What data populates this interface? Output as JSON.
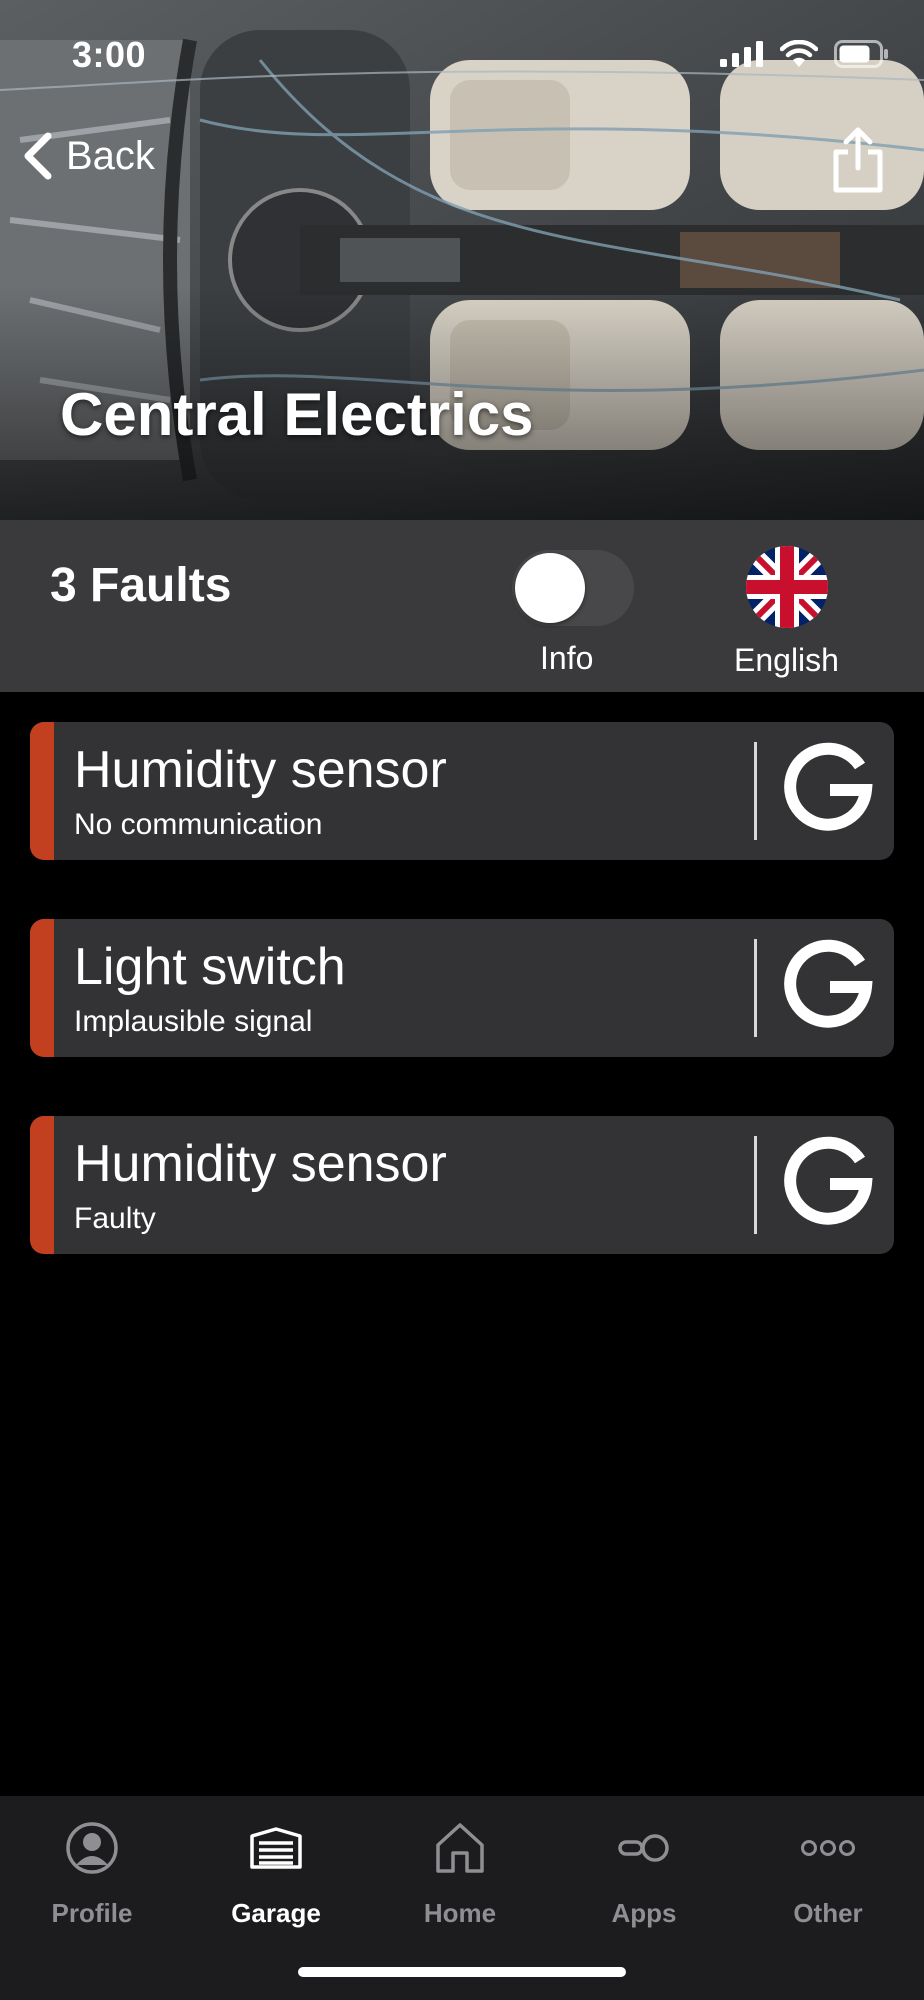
{
  "status_bar": {
    "time": "3:00"
  },
  "nav": {
    "back_label": "Back"
  },
  "hero": {
    "title": "Central Electrics"
  },
  "summary": {
    "fault_count_label": "3 Faults",
    "info_toggle_label": "Info",
    "info_toggle_on": false,
    "language_label": "English"
  },
  "faults": [
    {
      "title": "Humidity sensor",
      "subtitle": "No communication",
      "severity_color": "#c2401f"
    },
    {
      "title": "Light switch",
      "subtitle": "Implausible signal",
      "severity_color": "#c2401f"
    },
    {
      "title": "Humidity sensor",
      "subtitle": "Faulty",
      "severity_color": "#c2401f"
    }
  ],
  "tabbar": {
    "items": [
      {
        "label": "Profile",
        "icon": "profile-icon",
        "active": false
      },
      {
        "label": "Garage",
        "icon": "garage-icon",
        "active": true
      },
      {
        "label": "Home",
        "icon": "home-icon",
        "active": false
      },
      {
        "label": "Apps",
        "icon": "apps-icon",
        "active": false
      },
      {
        "label": "Other",
        "icon": "more-icon",
        "active": false
      }
    ]
  },
  "colors": {
    "background": "#000000",
    "card": "#333335",
    "summary_bar": "#3a3a3c",
    "fault_accent": "#c2401f",
    "tab_active": "#ffffff",
    "tab_inactive": "#8e8e93"
  }
}
